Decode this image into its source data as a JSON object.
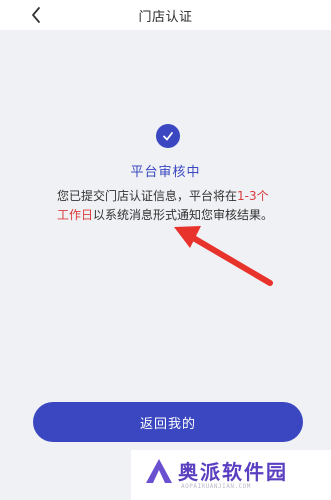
{
  "header": {
    "title": "门店认证",
    "back_icon": "chevron-left-icon"
  },
  "status": {
    "icon": "check-circle-icon",
    "title": "平台审核中",
    "message_parts": {
      "part1": "您已提交门店认证信息，平台将在",
      "highlight1": "1-3",
      "highlight2": "个工作日",
      "part2": "以系统消息形式通知您审核结果。"
    }
  },
  "actions": {
    "return_label": "返回我的"
  },
  "watermark": {
    "brand": "奥派软件园",
    "site": "AOPAIRUANJIAN.COM"
  },
  "colors": {
    "accent": "#3a47c1",
    "highlight": "#d93a3a",
    "annotation_arrow": "#e8322c",
    "background": "#f0f1f4"
  }
}
